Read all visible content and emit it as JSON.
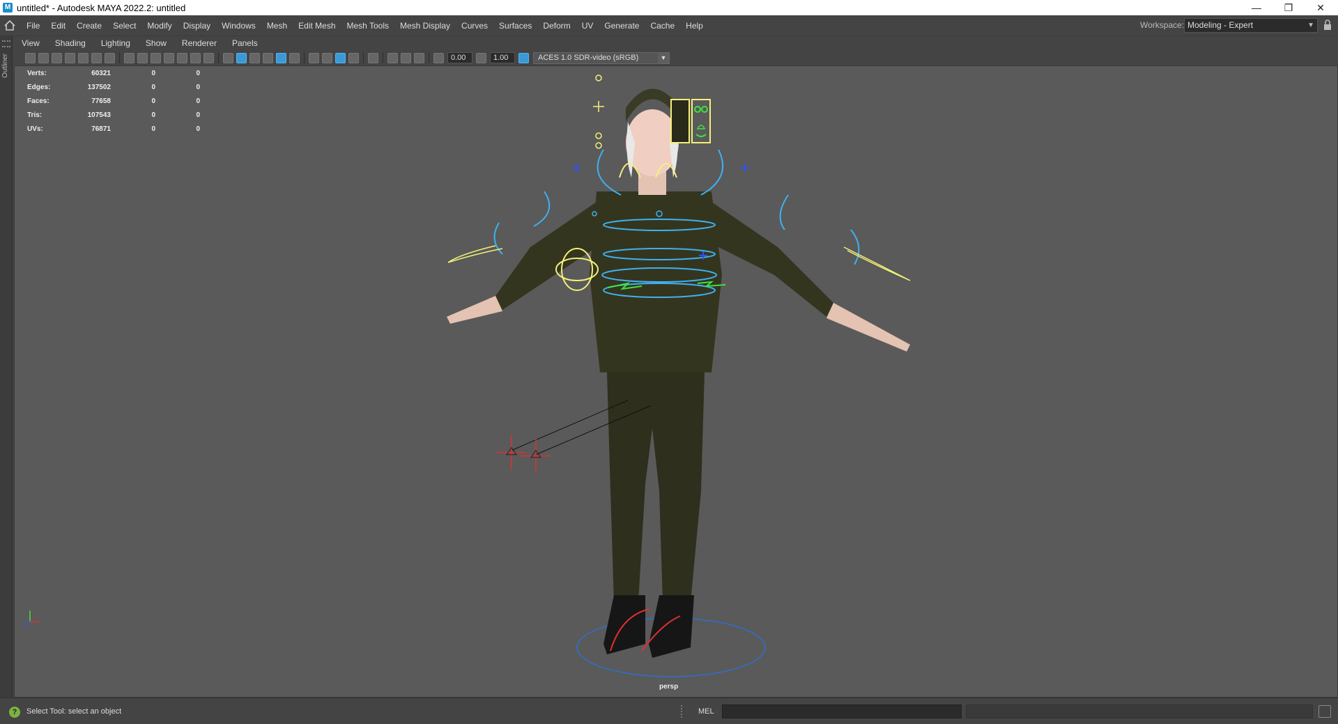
{
  "window": {
    "title": "untitled* - Autodesk MAYA 2022.2: untitled",
    "app_icon_letter": "M"
  },
  "menubar": {
    "items": [
      "File",
      "Edit",
      "Create",
      "Select",
      "Modify",
      "Display",
      "Windows",
      "Mesh",
      "Edit Mesh",
      "Mesh Tools",
      "Mesh Display",
      "Curves",
      "Surfaces",
      "Deform",
      "UV",
      "Generate",
      "Cache",
      "Help"
    ],
    "workspace_label": "Workspace:",
    "workspace_value": "Modeling - Expert"
  },
  "outliner": {
    "label": "Outliner"
  },
  "panel_menu": {
    "items": [
      "View",
      "Shading",
      "Lighting",
      "Show",
      "Renderer",
      "Panels"
    ]
  },
  "panel_toolbar": {
    "exposure_value": "0.00",
    "gamma_value": "1.00",
    "color_space": "ACES 1.0 SDR-video (sRGB)"
  },
  "hud": {
    "rows": [
      {
        "label": "Verts:",
        "value": "60321",
        "sel": "0",
        "comp": "0"
      },
      {
        "label": "Edges:",
        "value": "137502",
        "sel": "0",
        "comp": "0"
      },
      {
        "label": "Faces:",
        "value": "77658",
        "sel": "0",
        "comp": "0"
      },
      {
        "label": "Tris:",
        "value": "107543",
        "sel": "0",
        "comp": "0"
      },
      {
        "label": "UVs:",
        "value": "76871",
        "sel": "0",
        "comp": "0"
      }
    ]
  },
  "viewport": {
    "camera_label": "persp"
  },
  "statusbar": {
    "help_text": "Select Tool: select an object",
    "command_language": "MEL"
  },
  "colors": {
    "viewport_bg": "#5a5a5a",
    "ui_bg": "#444444",
    "accent": "#3a9ad9",
    "rig_blue": "#3fb1f0",
    "rig_yellow": "#f4f07a",
    "rig_green": "#3ee33e",
    "ik_red": "#e03030"
  }
}
